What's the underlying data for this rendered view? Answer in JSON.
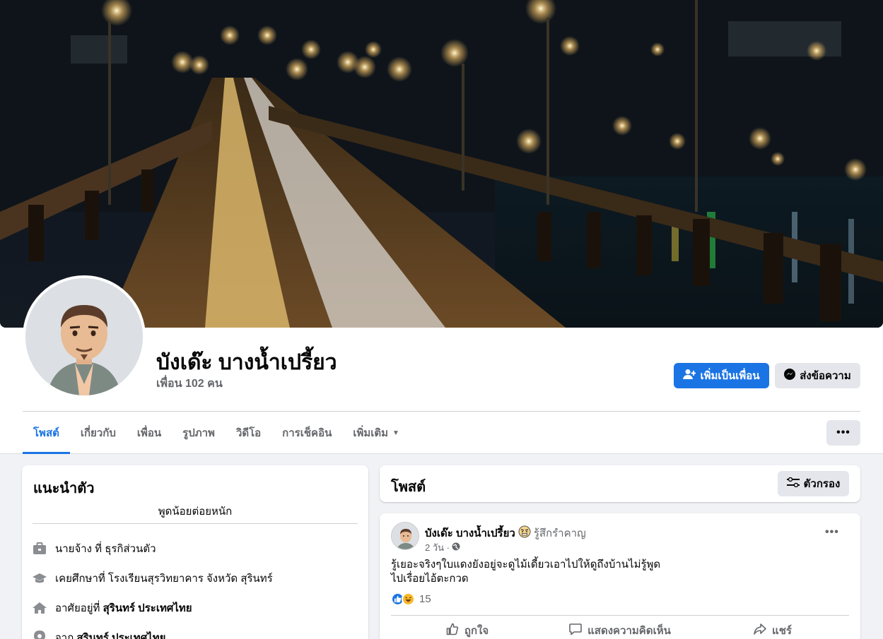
{
  "profile": {
    "name": "บังเด๊ะ บางน้ำเปรี้ยว",
    "friends_count": "เพื่อน 102 คน",
    "add_friend_label": "เพิ่มเป็นเพื่อน",
    "message_label": "ส่งข้อความ"
  },
  "tabs": [
    {
      "label": "โพสต์",
      "active": true
    },
    {
      "label": "เกี่ยวกับ"
    },
    {
      "label": "เพื่อน"
    },
    {
      "label": "รูปภาพ"
    },
    {
      "label": "วิดีโอ"
    },
    {
      "label": "การเช็คอิน"
    },
    {
      "label": "เพิ่มเติม"
    }
  ],
  "more_label": "•••",
  "intro": {
    "title": "แนะนำตัว",
    "bio": "พูดน้อยต่อยหนัก",
    "items": [
      {
        "icon": "briefcase-icon",
        "text": "นายจ้าง ที่ ธุรกิส่วนตัว",
        "bold": ""
      },
      {
        "icon": "graduation-cap-icon",
        "text": "เคยศึกษาที่ โรงเรียนสุรวิทยาคาร จังหวัด สุรินทร์",
        "bold": ""
      },
      {
        "icon": "home-icon",
        "text": "อาศัยอยู่ที่ ",
        "bold": "สุรินทร์ ประเทศไทย"
      },
      {
        "icon": "location-pin-icon",
        "text": "จาก ",
        "bold": "สุรินทร์ ประเทศไทย"
      }
    ]
  },
  "posts_header": {
    "title": "โพสต์",
    "filter_label": "ตัวกรอง"
  },
  "post": {
    "author": "บังเด๊ะ บางน้ำเปรี้ยว",
    "feeling": "รู้สึกรำคาญ",
    "time": "2 วัน ·",
    "menu": "•••",
    "text_lines": [
      "รู้เยอะจริงๆใบแดงยังอยู่จะดูไม้เดี้ยวเอาไปให้ดูถึงบ้านไม่รู้พูด",
      "ไปเรื่อยไอ้ตะกวด"
    ],
    "reaction_count": "15",
    "actions": {
      "like": "ถูกใจ",
      "comment": "แสดงความคิดเห็น",
      "share": "แชร์"
    }
  },
  "colors": {
    "accent": "#1b74e4",
    "secondary_btn": "#e4e6eb",
    "muted_text": "#65676b"
  }
}
